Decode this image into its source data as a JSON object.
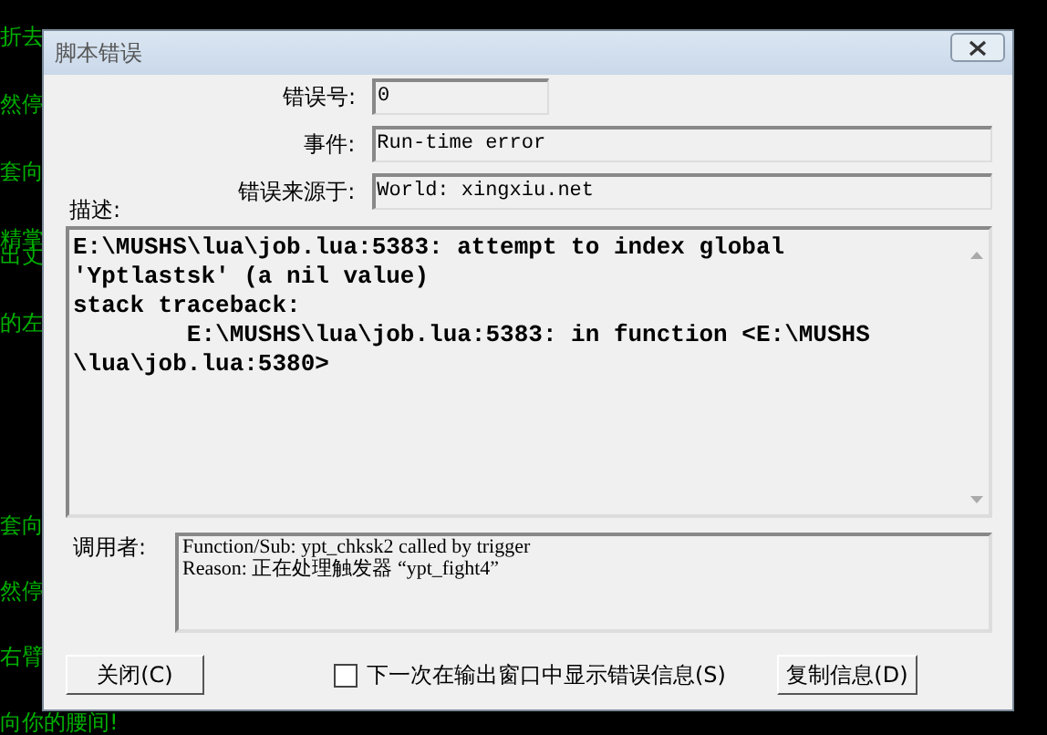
{
  "terminal": {
    "top_lines": [
      "折去",
      "然停",
      "套向",
      "精掌",
      "出丈",
      "的左"
    ],
    "bottom_lines": [
      "套向",
      "然停",
      "右臂",
      "向你的腰间!"
    ]
  },
  "dialog": {
    "title": "脚本错误",
    "fields": [
      {
        "label": "错误号:",
        "value": "0",
        "kind": "short"
      },
      {
        "label": "事件:",
        "value": "Run-time error",
        "kind": "wide"
      },
      {
        "label": "错误来源于:",
        "value": "World: xingxiu.net",
        "kind": "wide"
      }
    ],
    "description": {
      "label": "描述:",
      "lines": [
        "E:\\MUSHS\\lua\\job.lua:5383: attempt to index global",
        "'Yptlastsk' (a nil value)",
        "stack traceback:",
        "        E:\\MUSHS\\lua\\job.lua:5383: in function <E:\\MUSHS",
        "\\lua\\job.lua:5380>"
      ]
    },
    "caller": {
      "label": "调用者:",
      "lines": [
        "Function/Sub: ypt_chksk2 called by trigger",
        "Reason: 正在处理触发器 “ypt_fight4”"
      ]
    },
    "close_button": "关闭(C)",
    "show_in_output": {
      "label": "下一次在输出窗口中显示错误信息(S)",
      "checked": false
    },
    "copy_button": "复制信息(D)"
  }
}
